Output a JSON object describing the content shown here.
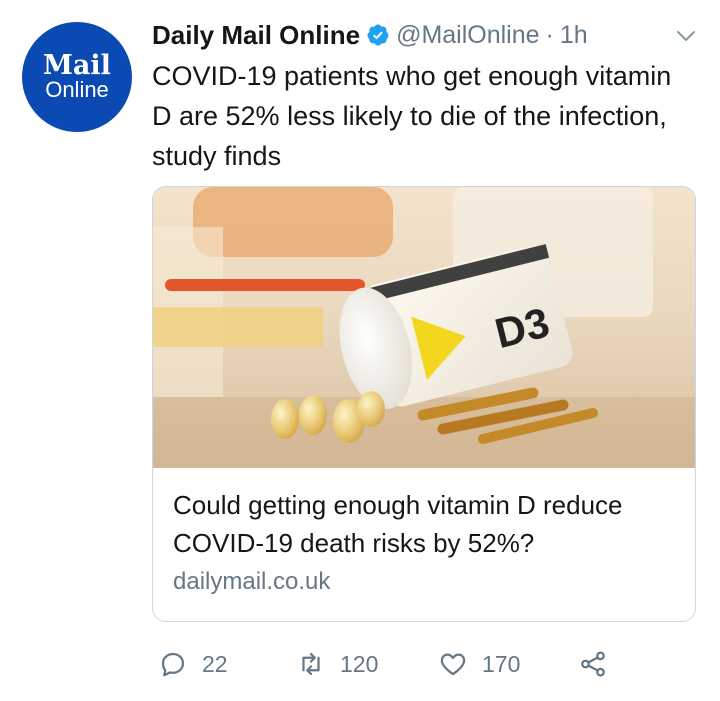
{
  "account": {
    "avatar_line1": "Mail",
    "avatar_line2": "Online",
    "display_name": "Daily Mail Online",
    "handle": "@MailOnline",
    "separator": "·",
    "time": "1h"
  },
  "tweet": {
    "text": "COVID-19 patients who get enough vitamin D are 52% less likely to die of the infection, study finds"
  },
  "card": {
    "image_label": "D3",
    "title": "Could getting enough vitamin D reduce COVID-19 death risks by 52%?",
    "domain": "dailymail.co.uk"
  },
  "actions": {
    "reply_count": "22",
    "retweet_count": "120",
    "like_count": "170"
  },
  "colors": {
    "brand_blue": "#0b49b3",
    "verified_blue": "#1da1f2",
    "secondary_text": "#657786",
    "border": "#ccd6dd"
  }
}
